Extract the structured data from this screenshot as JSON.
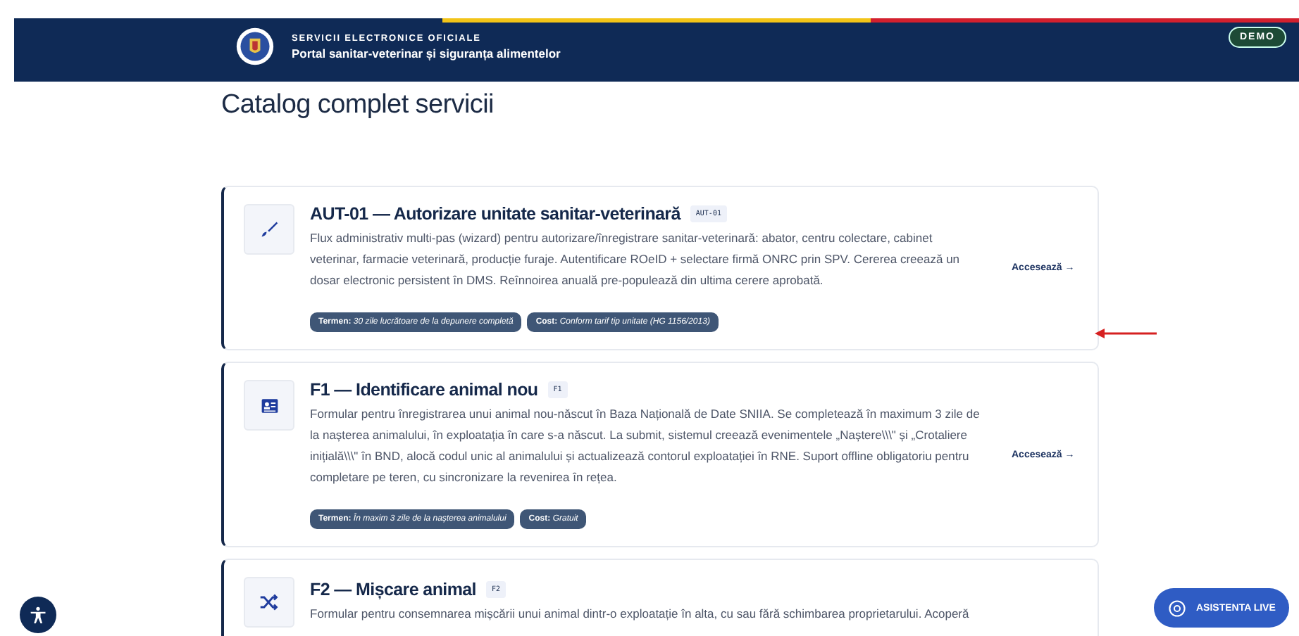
{
  "header": {
    "kicker": "SERVICII ELECTRONICE OFICIALE",
    "title": "Portal sanitar-veterinar și siguranța alimentelor",
    "badge": "DEMO"
  },
  "page_title": "Catalog complet servicii",
  "services": [
    {
      "kind": "brush",
      "title": "AUT-01 — Autorizare unitate sanitar-veterinară",
      "code": "AUT-01",
      "description": "Flux administrativ multi-pas (wizard) pentru autorizare/înregistrare sanitar-veterinară: abator, centru colectare, cabinet veterinar, farmacie veterinară, producție furaje. Autentificare ROeID + selectare firmă ONRC prin SPV. Cererea creează un dosar electronic persistent în DMS. Reînnoirea anuală pre-populează din ultima cerere aprobată.",
      "tags": [
        {
          "label": "Termen:",
          "value": "30 zile lucrătoare de la depunere completă"
        },
        {
          "label": "Cost:",
          "value": "Conform tarif tip unitate (HG 1156/2013)"
        }
      ],
      "action": "Accesează",
      "arrow": "→"
    },
    {
      "kind": "id-card",
      "title": "F1 — Identificare animal nou",
      "code": "F1",
      "description": "Formular pentru înregistrarea unui animal nou-născut în Baza Națională de Date SNIIA. Se completează în maximum 3 zile de la nașterea animalului, în exploatația în care s-a născut. La submit, sistemul creează evenimentele „Naștere\\\\\\\" și „Crotaliere inițială\\\\\\\" în BND, alocă codul unic al animalului și actualizează contorul exploatației în RNE. Suport offline obligatoriu pentru completare pe teren, cu sincronizare la revenirea în rețea.",
      "tags": [
        {
          "label": "Termen:",
          "value": "În maxim 3 zile de la nașterea animalului"
        },
        {
          "label": "Cost:",
          "value": "Gratuit"
        }
      ],
      "action": "Accesează",
      "arrow": "→"
    },
    {
      "kind": "shuffle",
      "title": "F2 — Mișcare animal",
      "code": "F2",
      "description": "Formular pentru consemnarea mișcării unui animal dintr-o exploatație în alta, cu sau fără schimbarea proprietarului. Acoperă"
    }
  ],
  "live_help": "ASISTENTA LIVE"
}
